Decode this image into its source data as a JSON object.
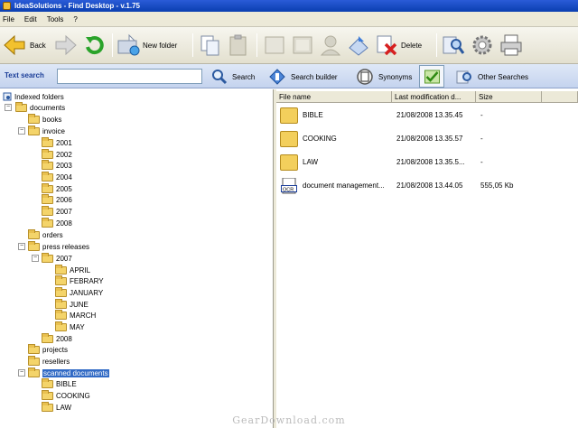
{
  "window": {
    "title": "IdeaSolutions - Find Desktop - v.1.75"
  },
  "menu": [
    "File",
    "Edit",
    "Tools",
    "?"
  ],
  "toolbar": {
    "back_label": "Back",
    "new_folder_label": "New folder",
    "delete_label": "Delete"
  },
  "search": {
    "label": "Text search",
    "value": "",
    "search_label": "Search",
    "builder_label": "Search builder",
    "synonyms_label": "Synonyms",
    "other_label": "Other Searches"
  },
  "tree": {
    "root": "Indexed folders",
    "items": [
      "documents",
      "books",
      "invoice",
      "2001",
      "2002",
      "2003",
      "2004",
      "2005",
      "2006",
      "2007",
      "2008",
      "orders",
      "press releases",
      "2007",
      "APRIL",
      "FEBRARY",
      "JANUARY",
      "JUNE",
      "MARCH",
      "MAY",
      "2008",
      "projects",
      "resellers",
      "scanned documents",
      "BIBLE",
      "COOKING",
      "LAW"
    ]
  },
  "list": {
    "headers": [
      "File name",
      "Last modification d...",
      "Size"
    ],
    "rows": [
      {
        "name": "BIBLE",
        "date": "21/08/2008 13.35.45",
        "size": "-",
        "icon": "folder-icon"
      },
      {
        "name": "COOKING",
        "date": "21/08/2008 13.35.57",
        "size": "-",
        "icon": "folder-icon"
      },
      {
        "name": "LAW",
        "date": "21/08/2008 13.35.5...",
        "size": "-",
        "icon": "folder-icon"
      },
      {
        "name": "document management...",
        "date": "21/08/2008 13.44.05",
        "size": "555,05 Kb",
        "icon": "ocr-file-icon"
      }
    ]
  },
  "watermark": "GearDownload.com"
}
